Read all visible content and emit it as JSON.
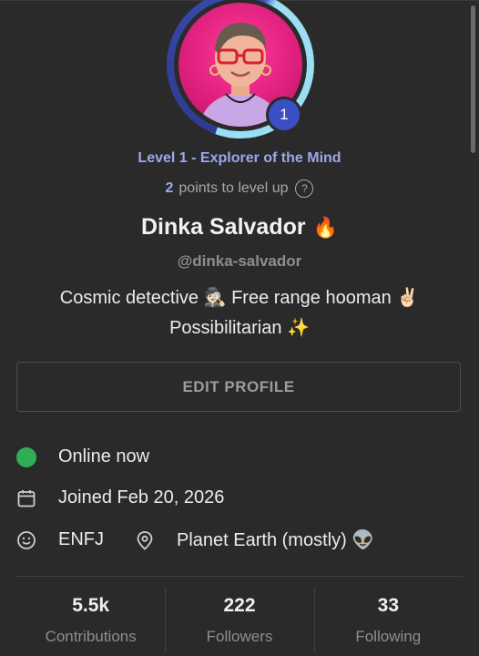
{
  "profile": {
    "level_badge": "1",
    "level_title": "Level 1 - Explorer of the Mind",
    "points_value": "2",
    "points_text": "points to level up",
    "display_name": "Dinka Salvador",
    "name_emoji": "🔥",
    "username": "@dinka-salvador",
    "bio_line1": "Cosmic detective 🕵🏻 Free range hooman ✌🏻",
    "bio_line2": "Possibilitarian ✨"
  },
  "actions": {
    "edit_profile_label": "EDIT PROFILE"
  },
  "info": {
    "status": "Online now",
    "joined": "Joined Feb 20, 2026",
    "personality": "ENFJ",
    "location": "Planet Earth (mostly) 👽"
  },
  "stats": [
    {
      "value": "5.5k",
      "label": "Contributions"
    },
    {
      "value": "222",
      "label": "Followers"
    },
    {
      "value": "33",
      "label": "Following"
    }
  ],
  "colors": {
    "background": "#2a2a2b",
    "accent": "#9aa8ee",
    "badge": "#3a4fc4",
    "online": "#2fae57"
  },
  "icons": {
    "help": "help-circle-icon",
    "calendar": "calendar-icon",
    "personality": "smiley-icon",
    "location": "map-pin-icon"
  }
}
